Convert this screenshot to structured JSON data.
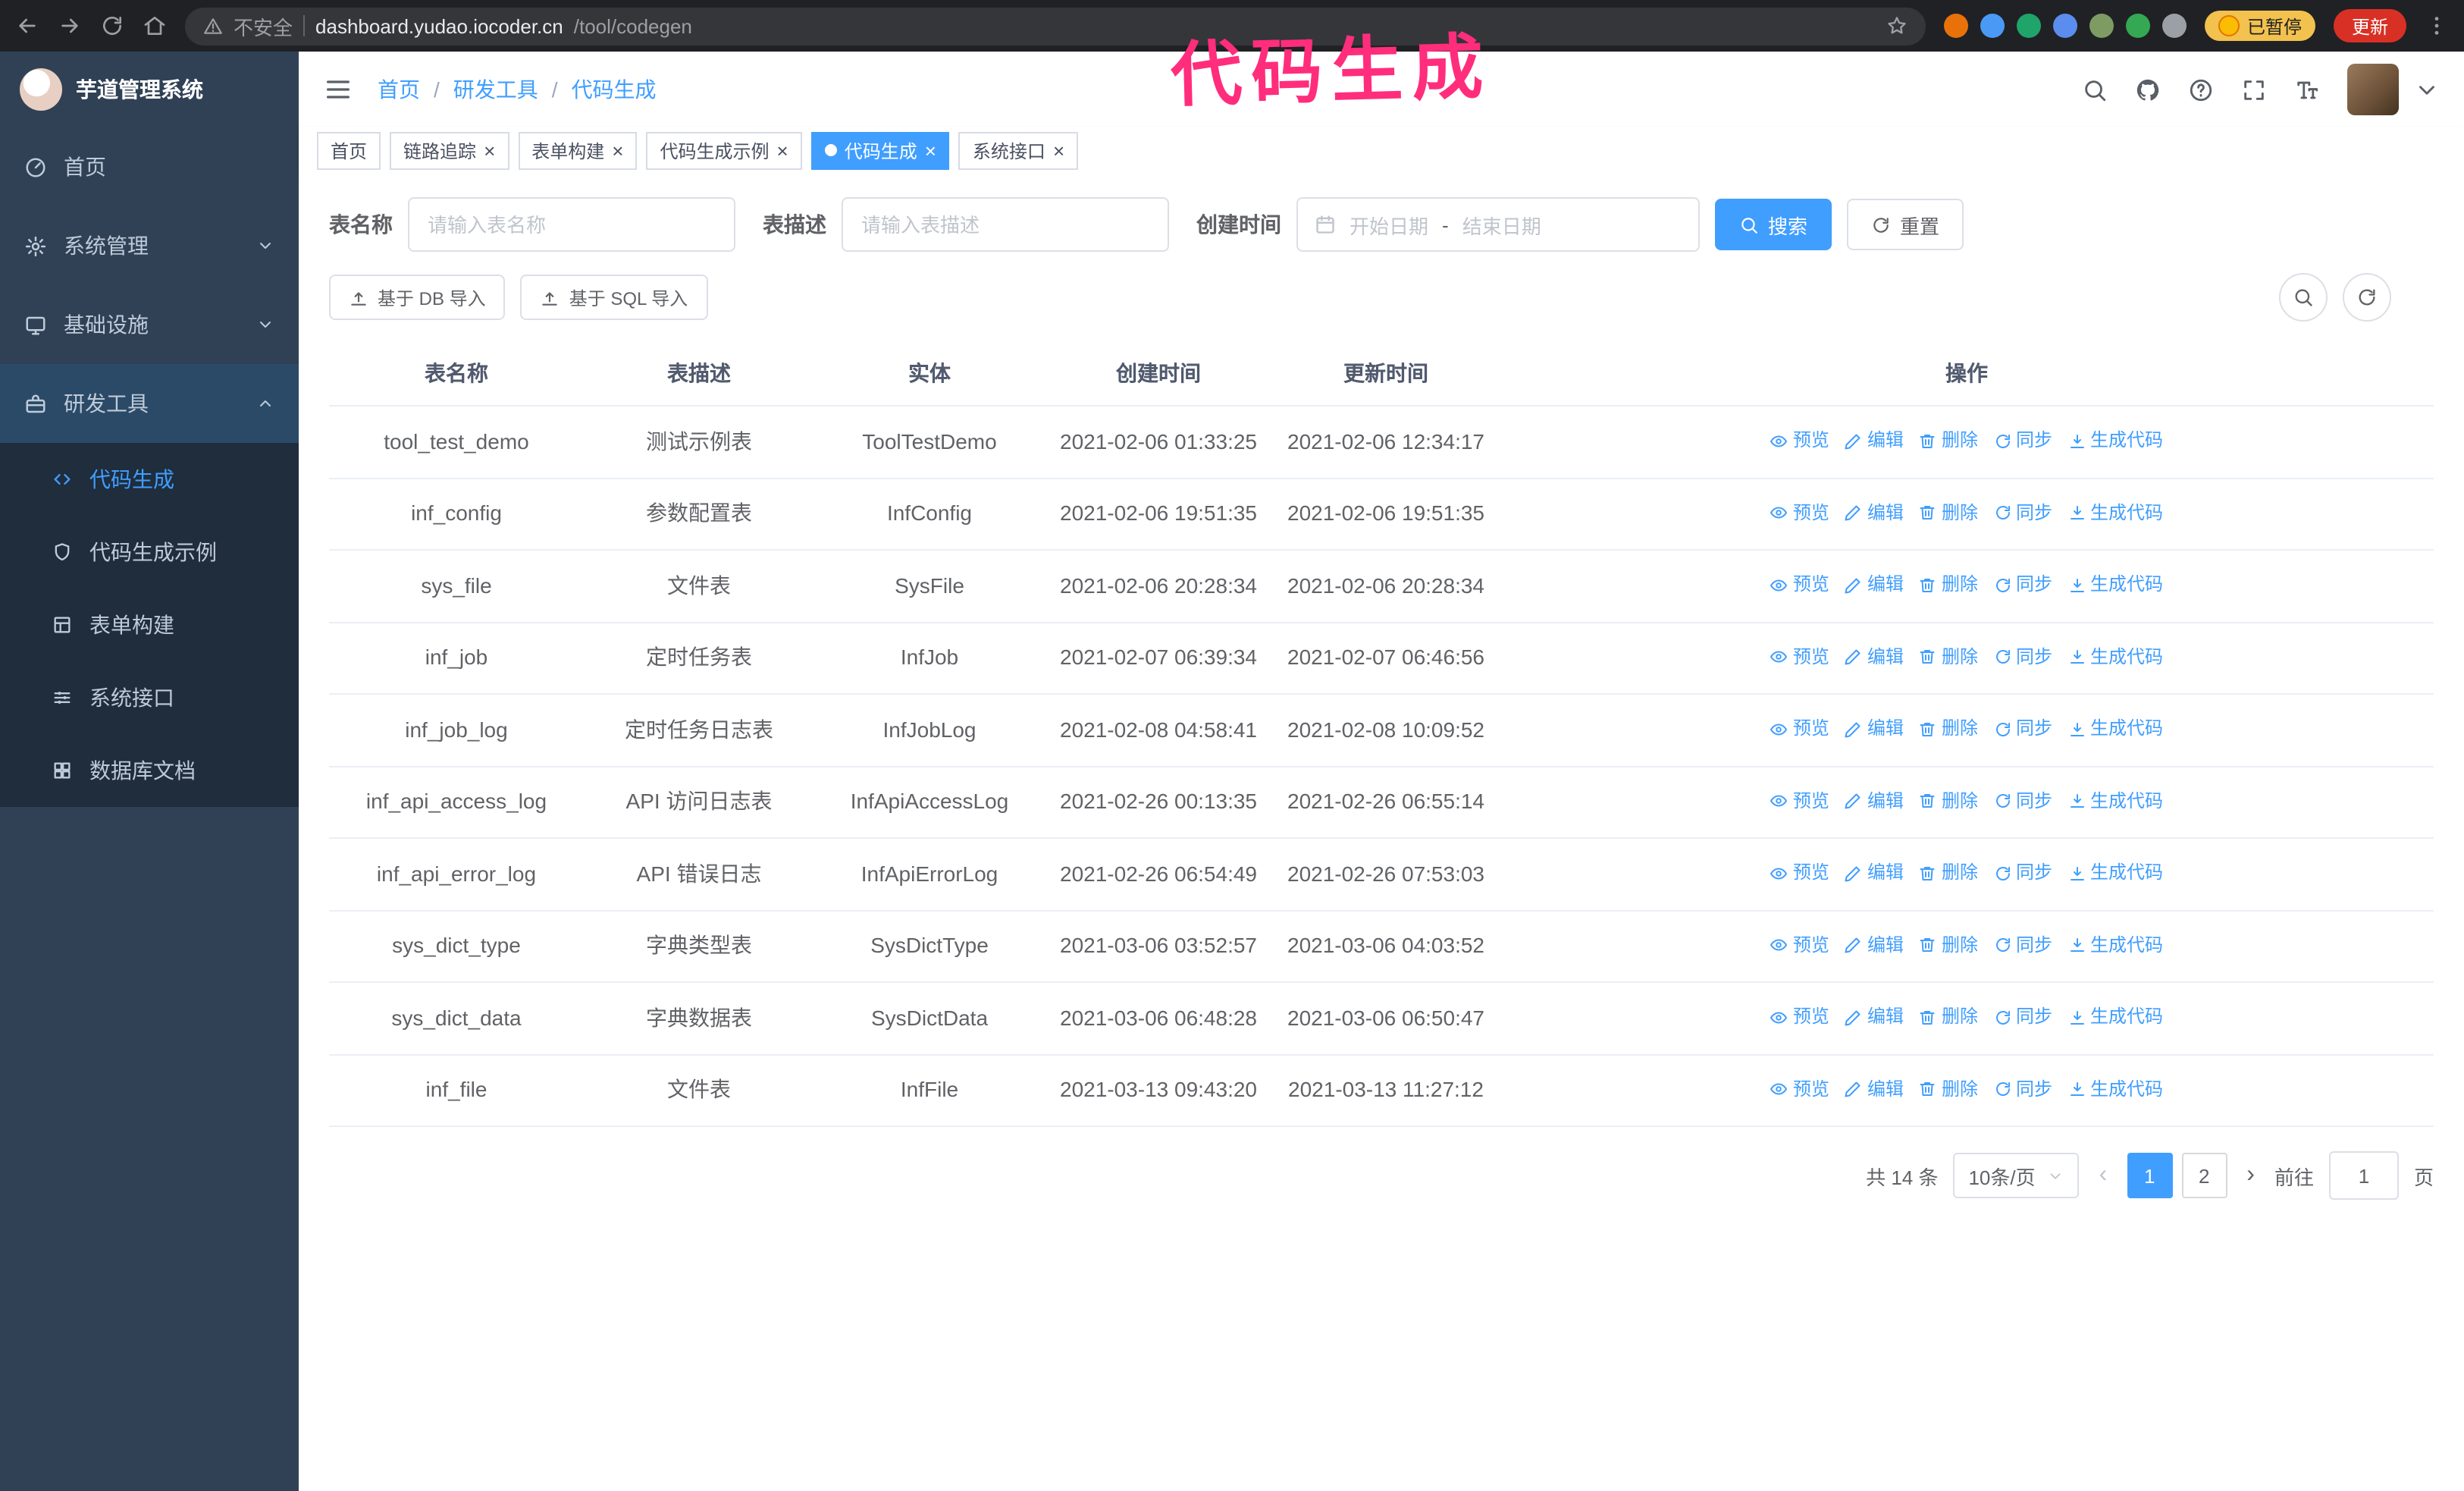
{
  "annotation": {
    "text": "代码生成",
    "color": "#ff2d7c"
  },
  "colors": {
    "accent": "#409eff",
    "sidebar_bg": "#304156",
    "submenu_bg": "#1f2d3d",
    "active_tab_bg": "#409eff"
  },
  "browser": {
    "security_warning": "不安全",
    "url_host": "dashboard.yudao.iocoder.cn",
    "url_path": "/tool/codegen",
    "paused_badge": "已暂停",
    "update_button": "更新",
    "extensions": [
      {
        "id": "fox",
        "color": "#e8710a"
      },
      {
        "id": "drop",
        "color": "#4a9af5"
      },
      {
        "id": "check",
        "color": "#1fa46a"
      },
      {
        "id": "people",
        "color": "#5b8def"
      },
      {
        "id": "capture",
        "color": "#7d9b62"
      },
      {
        "id": "leaf",
        "color": "#34a853"
      },
      {
        "id": "puzzle",
        "color": "#9aa0a6"
      }
    ]
  },
  "sidebar": {
    "logo_title": "芋道管理系统",
    "items": [
      {
        "id": "home",
        "label": "首页",
        "icon": "dashboard",
        "expandable": false,
        "expanded": false
      },
      {
        "id": "system-management",
        "label": "系统管理",
        "icon": "gear",
        "expandable": true,
        "expanded": false
      },
      {
        "id": "infrastructure",
        "label": "基础设施",
        "icon": "monitor",
        "expandable": true,
        "expanded": false
      },
      {
        "id": "dev-tools",
        "label": "研发工具",
        "icon": "toolbox",
        "expandable": true,
        "expanded": true
      }
    ],
    "submenu": [
      {
        "id": "code-generation",
        "label": "代码生成",
        "icon": "code",
        "active": true
      },
      {
        "id": "codegen-example",
        "label": "代码生成示例",
        "icon": "shield",
        "active": false
      },
      {
        "id": "form-builder",
        "label": "表单构建",
        "icon": "formtable",
        "active": false
      },
      {
        "id": "system-api",
        "label": "系统接口",
        "icon": "sliders",
        "active": false
      },
      {
        "id": "db-document",
        "label": "数据库文档",
        "icon": "grid",
        "active": false
      }
    ]
  },
  "header": {
    "breadcrumb": [
      "首页",
      "研发工具",
      "代码生成"
    ],
    "separator": "/"
  },
  "tabs": [
    {
      "id": "home",
      "label": "首页",
      "closable": false,
      "active": false
    },
    {
      "id": "trace",
      "label": "链路追踪",
      "closable": true,
      "active": false
    },
    {
      "id": "form-builder",
      "label": "表单构建",
      "closable": true,
      "active": false
    },
    {
      "id": "codegen-example",
      "label": "代码生成示例",
      "closable": true,
      "active": false
    },
    {
      "id": "code-generation",
      "label": "代码生成",
      "closable": true,
      "active": true
    },
    {
      "id": "system-api",
      "label": "系统接口",
      "closable": true,
      "active": false
    }
  ],
  "filters": {
    "table_name_label": "表名称",
    "table_name_placeholder": "请输入表名称",
    "table_desc_label": "表描述",
    "table_desc_placeholder": "请输入表描述",
    "create_time_label": "创建时间",
    "date_start_placeholder": "开始日期",
    "date_separator": "-",
    "date_end_placeholder": "结束日期",
    "search_button": "搜索",
    "reset_button": "重置"
  },
  "toolbar": {
    "import_db": "基于 DB 导入",
    "import_sql": "基于 SQL 导入"
  },
  "table": {
    "columns": [
      "表名称",
      "表描述",
      "实体",
      "创建时间",
      "更新时间",
      "操作"
    ],
    "action_labels": [
      "预览",
      "编辑",
      "删除",
      "同步",
      "生成代码"
    ],
    "rows": [
      {
        "name": "tool_test_demo",
        "desc": "测试示例表",
        "entity": "ToolTestDemo",
        "created": "2021-02-06 01:33:25",
        "updated": "2021-02-06 12:34:17"
      },
      {
        "name": "inf_config",
        "desc": "参数配置表",
        "entity": "InfConfig",
        "created": "2021-02-06 19:51:35",
        "updated": "2021-02-06 19:51:35"
      },
      {
        "name": "sys_file",
        "desc": "文件表",
        "entity": "SysFile",
        "created": "2021-02-06 20:28:34",
        "updated": "2021-02-06 20:28:34"
      },
      {
        "name": "inf_job",
        "desc": "定时任务表",
        "entity": "InfJob",
        "created": "2021-02-07 06:39:34",
        "updated": "2021-02-07 06:46:56"
      },
      {
        "name": "inf_job_log",
        "desc": "定时任务日志表",
        "entity": "InfJobLog",
        "created": "2021-02-08 04:58:41",
        "updated": "2021-02-08 10:09:52"
      },
      {
        "name": "inf_api_access_log",
        "desc": "API 访问日志表",
        "entity": "InfApiAccessLog",
        "created": "2021-02-26 00:13:35",
        "updated": "2021-02-26 06:55:14"
      },
      {
        "name": "inf_api_error_log",
        "desc": "API 错误日志",
        "entity": "InfApiErrorLog",
        "created": "2021-02-26 06:54:49",
        "updated": "2021-02-26 07:53:03"
      },
      {
        "name": "sys_dict_type",
        "desc": "字典类型表",
        "entity": "SysDictType",
        "created": "2021-03-06 03:52:57",
        "updated": "2021-03-06 04:03:52"
      },
      {
        "name": "sys_dict_data",
        "desc": "字典数据表",
        "entity": "SysDictData",
        "created": "2021-03-06 06:48:28",
        "updated": "2021-03-06 06:50:47"
      },
      {
        "name": "inf_file",
        "desc": "文件表",
        "entity": "InfFile",
        "created": "2021-03-13 09:43:20",
        "updated": "2021-03-13 11:27:12"
      }
    ]
  },
  "pagination": {
    "total": "共 14 条",
    "page_size": "10条/页",
    "pages": [
      "1",
      "2"
    ],
    "active_page": "1",
    "prev": "‹",
    "next": "›",
    "goto_label": "前往",
    "goto_value": "1",
    "goto_suffix": "页"
  },
  "icons": {
    "close": "×"
  }
}
